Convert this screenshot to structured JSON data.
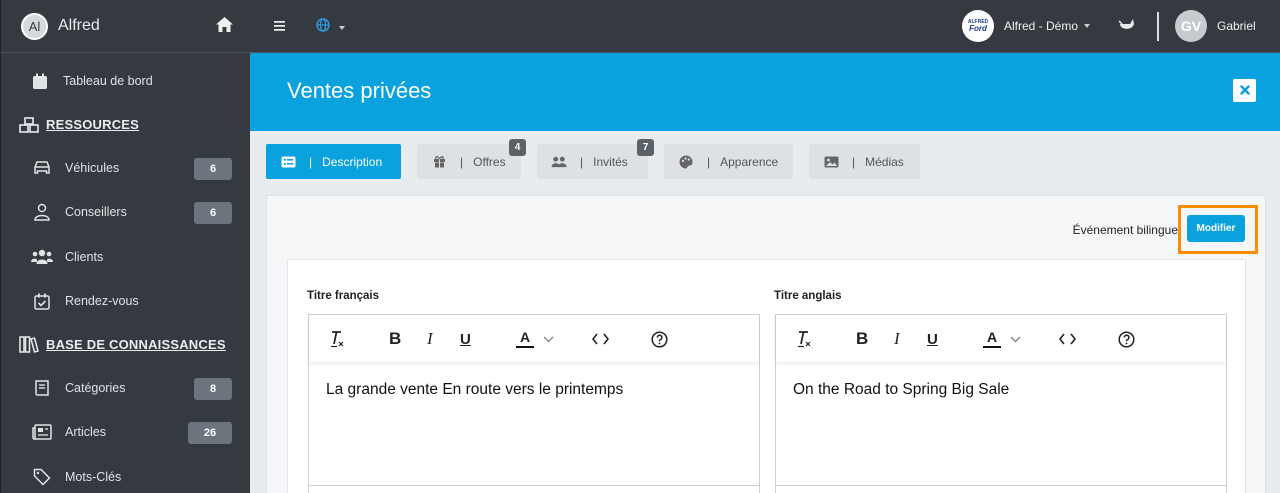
{
  "brand": {
    "initials": "Al",
    "name": "Alfred"
  },
  "sidebar": {
    "dashboard": "Tableau de bord",
    "resources_header": "RESSOURCES",
    "resources": [
      {
        "label": "Véhicules",
        "count": "6"
      },
      {
        "label": "Conseillers",
        "count": "6"
      },
      {
        "label": "Clients",
        "count": ""
      },
      {
        "label": "Rendez-vous",
        "count": ""
      }
    ],
    "knowledge_header": "BASE DE CONNAISSANCES",
    "knowledge": [
      {
        "label": "Catégories",
        "count": "8"
      },
      {
        "label": "Articles",
        "count": "26"
      },
      {
        "label": "Mots-Clés",
        "count": ""
      }
    ]
  },
  "topbar": {
    "dealer_logo_top": "ALFRED",
    "dealer_logo_main": "Ford",
    "dealer_name": "Alfred - Démo",
    "user_initials": "GV",
    "user_name": "Gabriel"
  },
  "page": {
    "title": "Ventes privées"
  },
  "tabs": [
    {
      "label": "Description",
      "count": ""
    },
    {
      "label": "Offres",
      "count": "4"
    },
    {
      "label": "Invités",
      "count": "7"
    },
    {
      "label": "Apparence",
      "count": ""
    },
    {
      "label": "Médias",
      "count": ""
    }
  ],
  "card": {
    "bilingual_label": "Événement bilingue",
    "modify_button": "Modifier"
  },
  "fields": {
    "fr": {
      "label": "Titre français",
      "value": "La grande vente En route vers le printemps"
    },
    "en": {
      "label": "Titre anglais",
      "value": "On the Road to Spring Big Sale"
    }
  },
  "colors": {
    "primary": "#0aa1df",
    "sidebar": "#343a40",
    "highlight": "#ff8c00"
  }
}
